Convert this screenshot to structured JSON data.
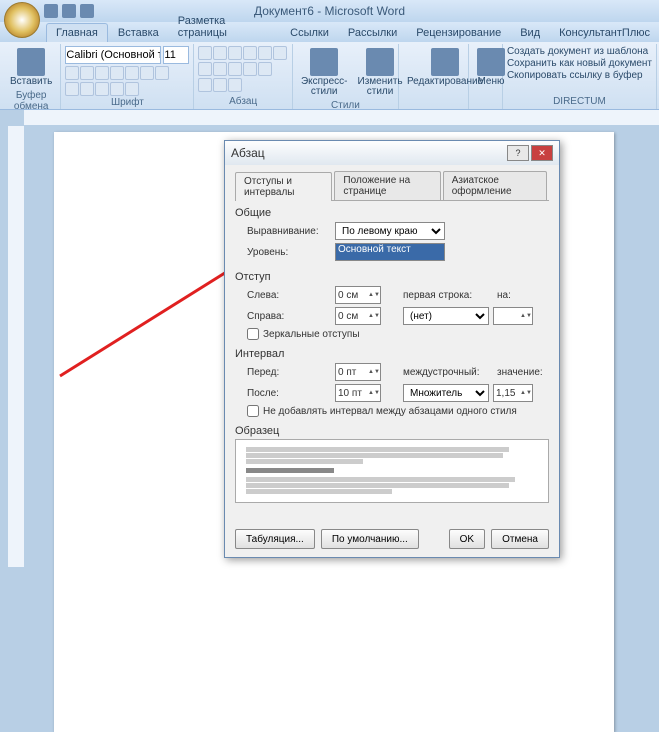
{
  "title": "Документ6 - Microsoft Word",
  "tabs": [
    "Главная",
    "Вставка",
    "Разметка страницы",
    "Ссылки",
    "Рассылки",
    "Рецензирование",
    "Вид",
    "КонсультантПлюс"
  ],
  "ribbon": {
    "clipboard": {
      "label": "Буфер обмена",
      "paste": "Вставить"
    },
    "font": {
      "label": "Шрифт",
      "name": "Calibri (Основной те",
      "size": "11"
    },
    "paragraph": {
      "label": "Абзац"
    },
    "styles": {
      "label": "Стили",
      "quick": "Экспресс-стили",
      "change": "Изменить\nстили"
    },
    "editing": {
      "label": "",
      "edit": "Редактирование"
    },
    "menu": {
      "label": "",
      "menu": "Меню"
    },
    "directum": {
      "label": "DIRECTUM",
      "l1": "Создать документ из шаблона",
      "l2": "Сохранить как новый документ",
      "l3": "Скопировать ссылку в буфер"
    }
  },
  "dialog": {
    "title": "Абзац",
    "tabs": [
      "Отступы и интервалы",
      "Положение на странице",
      "Азиатское оформление"
    ],
    "general": "Общие",
    "align_label": "Выравнивание:",
    "align_value": "По левому краю",
    "level_label": "Уровень:",
    "level_value": "Основной текст",
    "indent": "Отступ",
    "left_label": "Слева:",
    "left_value": "0 см",
    "right_label": "Справа:",
    "right_value": "0 см",
    "first_label": "первая строка:",
    "first_value": "(нет)",
    "by_label": "на:",
    "mirror": "Зеркальные отступы",
    "spacing": "Интервал",
    "before_label": "Перед:",
    "before_value": "0 пт",
    "after_label": "После:",
    "after_value": "10 пт",
    "line_label": "междустрочный:",
    "line_value": "Множитель",
    "at_label": "значение:",
    "at_value": "1,15",
    "noadd": "Не добавлять интервал между абзацами одного стиля",
    "preview": "Образец",
    "tabbtn": "Табуляция...",
    "default": "По умолчанию...",
    "ok": "OK",
    "cancel": "Отмена"
  }
}
